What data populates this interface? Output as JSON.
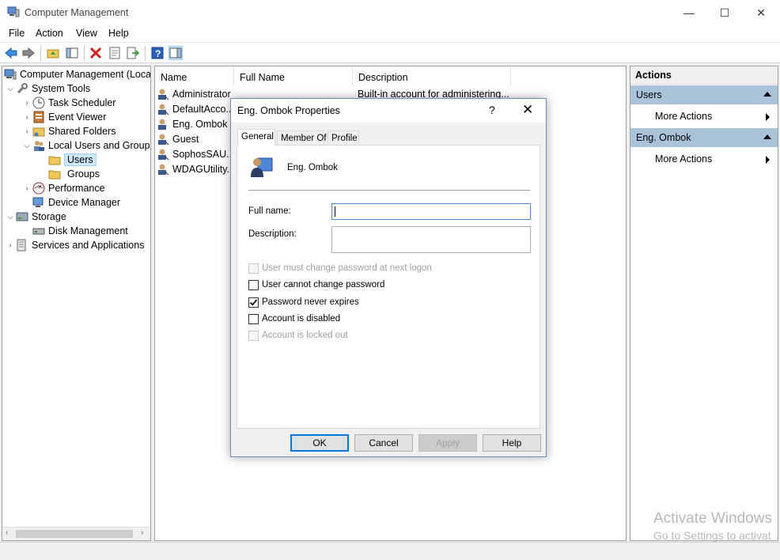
{
  "window": {
    "title": "Computer Management",
    "minimize": "—",
    "maximize": "☐",
    "close": "✕"
  },
  "menu": [
    "File",
    "Action",
    "View",
    "Help"
  ],
  "tree": {
    "root": "Computer Management (Local",
    "system_tools": "System Tools",
    "task_scheduler": "Task Scheduler",
    "event_viewer": "Event Viewer",
    "shared_folders": "Shared Folders",
    "local_users_groups": "Local Users and Groups",
    "users": "Users",
    "groups": "Groups",
    "performance": "Performance",
    "device_manager": "Device Manager",
    "storage": "Storage",
    "disk_management": "Disk Management",
    "services_apps": "Services and Applications"
  },
  "list": {
    "columns": [
      "Name",
      "Full Name",
      "Description"
    ],
    "rows": [
      {
        "name": "Administrator",
        "description": "Built-in account for administering..."
      },
      {
        "name": "DefaultAcco...",
        "description": ""
      },
      {
        "name": "Eng. Ombok",
        "description": ""
      },
      {
        "name": "Guest",
        "description": ""
      },
      {
        "name": "SophosSAU...",
        "description": ""
      },
      {
        "name": "WDAGUtility...",
        "description": ""
      }
    ]
  },
  "actions": {
    "header": "Actions",
    "section1": "Users",
    "section1_item": "More Actions",
    "section2": "Eng. Ombok",
    "section2_item": "More Actions"
  },
  "dialog": {
    "title": "Eng. Ombok Properties",
    "help": "?",
    "close": "✕",
    "tabs": [
      "General",
      "Member Of",
      "Profile"
    ],
    "username": "Eng. Ombok",
    "full_name_label": "Full name:",
    "full_name_value": "",
    "description_label": "Description:",
    "description_value": "",
    "checkboxes": [
      {
        "label": "User must change password at next logon",
        "checked": false,
        "enabled": false
      },
      {
        "label": "User cannot change password",
        "checked": false,
        "enabled": true
      },
      {
        "label": "Password never expires",
        "checked": true,
        "enabled": true
      },
      {
        "label": "Account is disabled",
        "checked": false,
        "enabled": true
      },
      {
        "label": "Account is locked out",
        "checked": false,
        "enabled": false
      }
    ],
    "buttons": {
      "ok": "OK",
      "cancel": "Cancel",
      "apply": "Apply",
      "help": "Help"
    }
  },
  "watermark": {
    "line1": "Activate Windows",
    "line2": "Go to Settings to activat"
  }
}
